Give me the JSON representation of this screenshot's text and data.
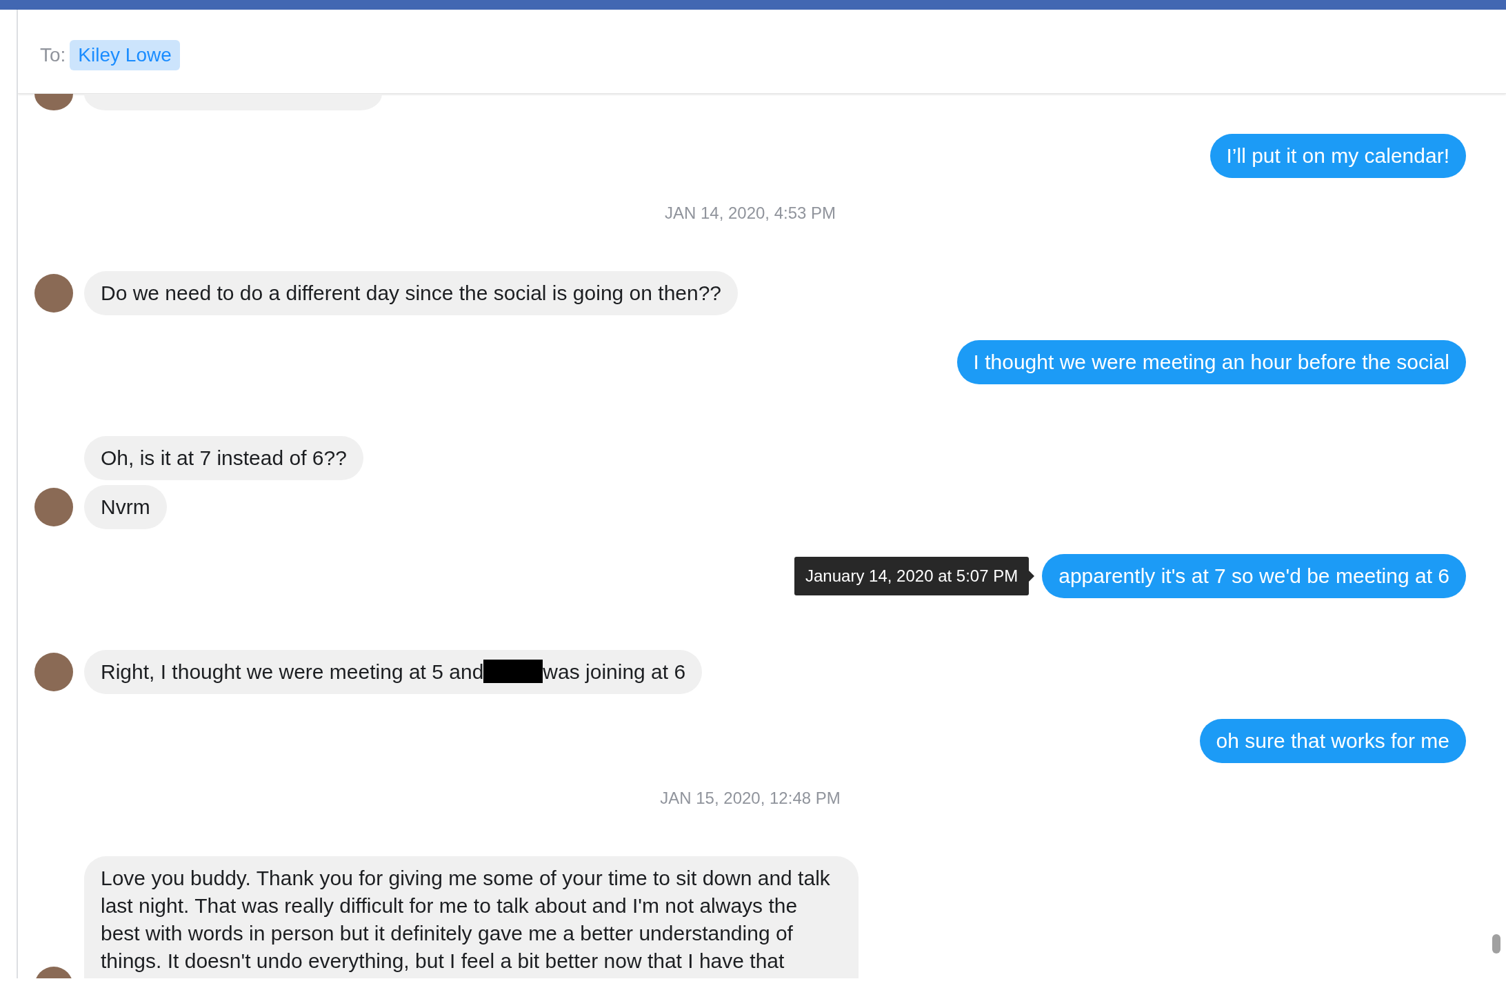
{
  "header": {
    "to_label": "To:",
    "recipient": "Kiley Lowe"
  },
  "messages": [
    {
      "kind": "clipped",
      "show_avatar": true
    },
    {
      "kind": "outgoing",
      "text": "I’ll put it on my calendar!"
    },
    {
      "kind": "timestamp",
      "text": "JAN 14, 2020, 4:53 PM"
    },
    {
      "kind": "incoming",
      "text": "Do we need to do a different day since the social is going on then??",
      "show_avatar": true
    },
    {
      "kind": "outgoing",
      "text": "I thought we were meeting an hour before the social"
    },
    {
      "kind": "incoming",
      "text": "Oh, is it at 7 instead of 6??",
      "show_avatar": false
    },
    {
      "kind": "incoming",
      "text": "Nvrm",
      "show_avatar": true
    },
    {
      "kind": "outgoing",
      "text": "apparently it's at 7 so we'd be meeting at 6",
      "tooltip": "January 14, 2020 at 5:07 PM"
    },
    {
      "kind": "incoming",
      "text": "Right, I thought we were meeting at 5 and",
      "redacted": true,
      "text_after": "was joining at 6",
      "show_avatar": true
    },
    {
      "kind": "outgoing",
      "text": "oh sure that works for me"
    },
    {
      "kind": "timestamp",
      "text": "JAN 15, 2020, 12:48 PM"
    },
    {
      "kind": "incoming",
      "text": "Love you buddy. Thank you for giving me some of your time to sit down and talk last night. That was really difficult for me to talk about and I'm not always the best with words in person but it definitely gave me a better understanding of things. It doesn't undo everything, but I feel a bit better now that I have that",
      "show_avatar": true,
      "long": true
    }
  ]
}
